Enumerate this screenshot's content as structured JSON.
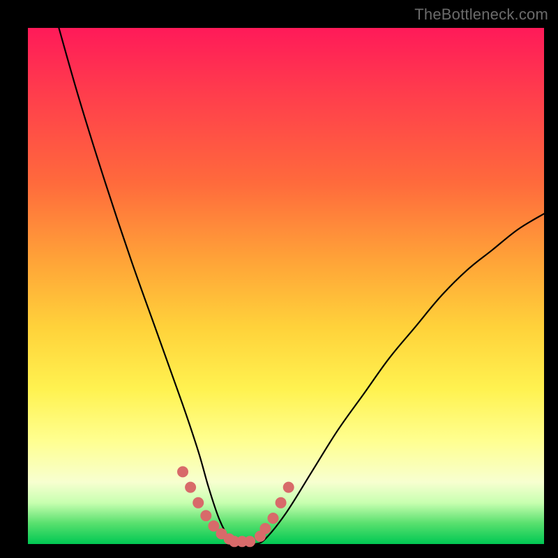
{
  "watermark": "TheBottleneck.com",
  "chart_data": {
    "type": "line",
    "title": "",
    "xlabel": "",
    "ylabel": "",
    "xlim": [
      0,
      100
    ],
    "ylim": [
      0,
      100
    ],
    "grid": false,
    "legend": false,
    "series": [
      {
        "name": "curve",
        "x": [
          6,
          10,
          15,
          20,
          25,
          30,
          33,
          35,
          37,
          39,
          40,
          42,
          44,
          46,
          50,
          55,
          60,
          65,
          70,
          75,
          80,
          85,
          90,
          95,
          100
        ],
        "y": [
          100,
          86,
          70,
          55,
          41,
          27,
          18,
          11,
          5,
          1,
          0,
          0,
          0,
          1,
          6,
          14,
          22,
          29,
          36,
          42,
          48,
          53,
          57,
          61,
          64
        ]
      }
    ],
    "markers": {
      "name": "highlighted-points",
      "color": "#d86a6a",
      "x": [
        30,
        31.5,
        33,
        34.5,
        36,
        37.5,
        39,
        40,
        41.5,
        43,
        45,
        46,
        47.5,
        49,
        50.5
      ],
      "y": [
        14,
        11,
        8,
        5.5,
        3.5,
        2,
        1,
        0.5,
        0.5,
        0.5,
        1.5,
        3,
        5,
        8,
        11
      ]
    },
    "background_gradient_stops": [
      {
        "pos": 0,
        "color": "#ff1a59"
      },
      {
        "pos": 30,
        "color": "#ff6a3c"
      },
      {
        "pos": 58,
        "color": "#ffd23a"
      },
      {
        "pos": 80,
        "color": "#ffff90"
      },
      {
        "pos": 96,
        "color": "#58e06e"
      },
      {
        "pos": 100,
        "color": "#00c853"
      }
    ]
  }
}
